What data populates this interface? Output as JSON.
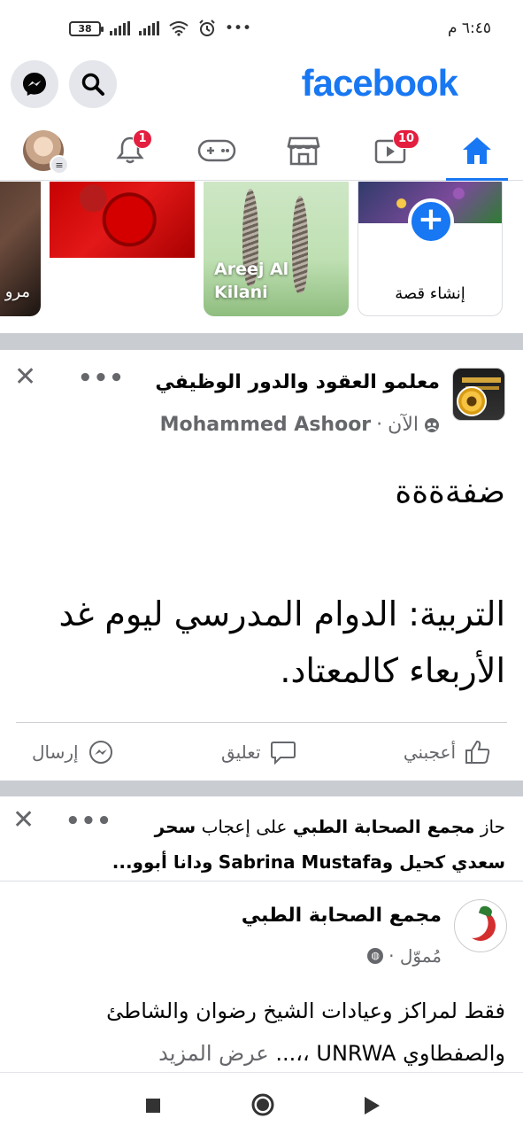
{
  "status_bar": {
    "time": "٦:٤٥ م",
    "battery": "38",
    "icons": [
      "signal-icon",
      "signal-icon",
      "wifi-icon",
      "alarm-icon",
      "more-dots-icon"
    ]
  },
  "header": {
    "logo": "facebook",
    "search_icon": "search-icon",
    "messenger_icon": "messenger-icon"
  },
  "nav": {
    "home_icon": "home-icon",
    "watch_icon": "video-icon",
    "watch_badge": "10",
    "marketplace_icon": "store-icon",
    "gaming_icon": "gamepad-icon",
    "notifications_icon": "bell-icon",
    "notifications_badge": "1",
    "profile_icon": "avatar-menu"
  },
  "stories": [
    {
      "type": "create",
      "label": "إنشاء قصة"
    },
    {
      "type": "story",
      "name": "Areej Al Kilani"
    },
    {
      "type": "story",
      "name": ""
    },
    {
      "type": "story",
      "name": "مرو"
    }
  ],
  "post1": {
    "page_name": "معلمو العقود والدور الوظيفي",
    "author": "Mohammed Ashoor",
    "time": "الآن",
    "line1": "ضفةةةة",
    "line2": "التربية: الدوام المدرسي ليوم غد الأربعاء كالمعتاد.",
    "actions": {
      "like": "أعجبني",
      "comment": "تعليق",
      "send": "إرسال"
    }
  },
  "post2": {
    "activity_prefix": "حاز",
    "activity_page": "مجمع الصحابة الطبي",
    "activity_mid": "على إعجاب",
    "activity_person1": "سحر",
    "activity_line2_a": "سعدي كحيل و",
    "activity_person2": "Sabrina Mustafa",
    "activity_line2_b": "ودانا أبوو...",
    "page_name": "مجمع الصحابة الطبي",
    "sponsored": "مُموّل ·",
    "text_line1": "فقط لمراكز وعيادات الشيخ رضوان والشاطئ",
    "text_line2": "والصفطاوي UNRWA ،،...",
    "see_more": "عرض المزيد"
  },
  "colors": {
    "brand": "#1877f2",
    "badge": "#e41e3f",
    "secondary_text": "#65676b",
    "divider": "#c9ccd1"
  }
}
